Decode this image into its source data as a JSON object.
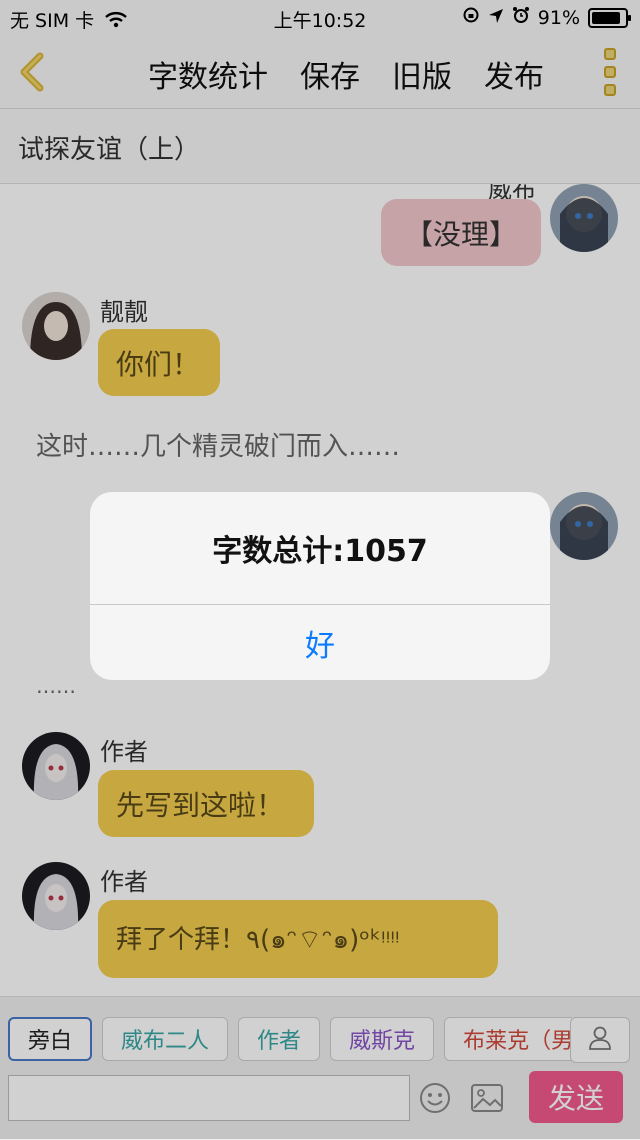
{
  "status_bar": {
    "carrier": "无 SIM 卡",
    "time": "上午10:52",
    "battery": "91%"
  },
  "nav": {
    "items": [
      "字数统计",
      "保存",
      "旧版",
      "发布"
    ]
  },
  "title": "试探友谊（上）",
  "chat": {
    "top_partial_name": "威布",
    "msg_top": "【没理】",
    "msg1": {
      "name": "靓靓",
      "text": "你们！"
    },
    "narration1": "这时……几个精灵破门而入……",
    "narration2": "……",
    "msg2": {
      "name": "作者",
      "text": "先写到这啦！"
    },
    "msg3": {
      "name": "作者",
      "text": "拜了个拜！٩(๑ᵔ⌔ᵔ๑)ᵒᵏᵎᵎᵎᵎ"
    }
  },
  "alert": {
    "message": "字数总计:1057",
    "ok": "好"
  },
  "roles": [
    {
      "label": "旁白",
      "color": "#222222",
      "selected": true
    },
    {
      "label": "威布二人",
      "color": "#3aa6a6",
      "selected": false
    },
    {
      "label": "作者",
      "color": "#3aa6a6",
      "selected": false
    },
    {
      "label": "威斯克",
      "color": "#8a56c8",
      "selected": false
    },
    {
      "label": "布莱克（男",
      "color": "#d24a3a",
      "selected": false
    }
  ],
  "input": {
    "placeholder": ""
  },
  "send_label": "发送",
  "icons": [
    "back-chevron-icon",
    "more-vertical-icon",
    "person-icon",
    "emoji-icon",
    "image-icon"
  ]
}
